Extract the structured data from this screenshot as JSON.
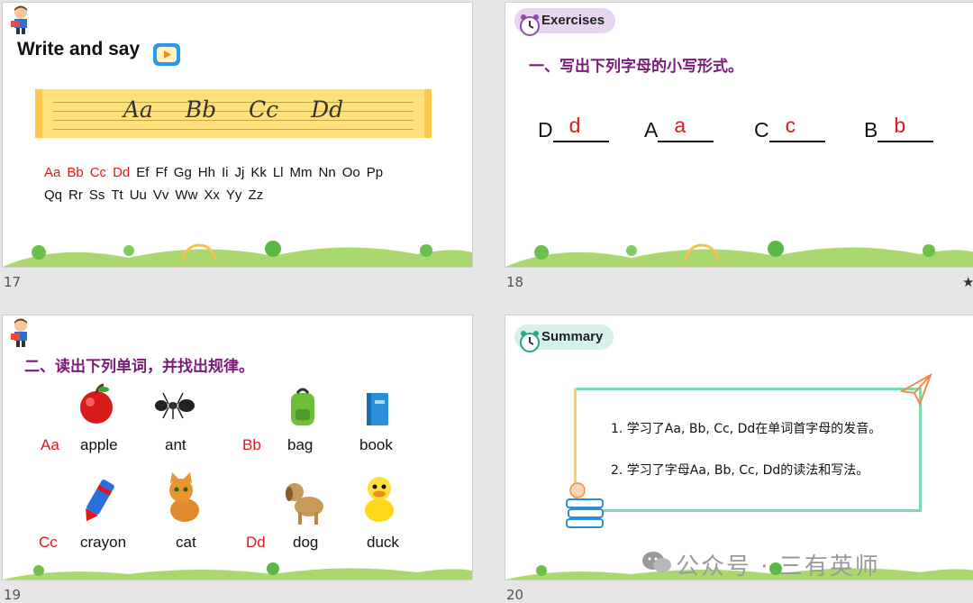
{
  "slides": {
    "s17": {
      "number": "17",
      "title": "Write and say",
      "band_text": "Aa Bb Cc Dd",
      "letters": [
        "Aa",
        "Bb",
        "Cc",
        "Dd",
        "Ef",
        "Ff",
        "Gg",
        "Hh",
        "Ii",
        "Jj",
        "Kk",
        "Ll",
        "Mm",
        "Nn",
        "Oo",
        "Pp",
        "Qq",
        "Rr",
        "Ss",
        "Tt",
        "Uu",
        "Vv",
        "Ww",
        "Xx",
        "Yy",
        "Zz"
      ],
      "highlighted_count": 4
    },
    "s18": {
      "number": "18",
      "badge": "Exercises",
      "heading": "一、写出下列字母的小写形式。",
      "exercises": [
        {
          "upper": "D",
          "answer": "d"
        },
        {
          "upper": "A",
          "answer": "a"
        },
        {
          "upper": "C",
          "answer": "c"
        },
        {
          "upper": "B",
          "answer": "b"
        }
      ]
    },
    "s19": {
      "number": "19",
      "heading": "二、读出下列单词，并找出规律。",
      "rows": [
        {
          "letter": "Aa",
          "words": [
            "apple",
            "ant"
          ]
        },
        {
          "letter": "Bb",
          "words": [
            "bag",
            "book"
          ]
        },
        {
          "letter": "Cc",
          "words": [
            "crayon",
            "cat"
          ]
        },
        {
          "letter": "Dd",
          "words": [
            "dog",
            "duck"
          ]
        }
      ]
    },
    "s20": {
      "number": "20",
      "badge": "Summary",
      "items": [
        "1. 学习了Aa, Bb, Cc, Dd在单词首字母的发音。",
        "2. 学习了字母Aa, Bb, Cc, Dd的读法和写法。"
      ]
    }
  },
  "watermark": "公众号 · 三有英师",
  "colors": {
    "red": "#e01818",
    "heading_purple": "#7a1a7a",
    "band_yellow": "#ffe07a",
    "frame_green": "#7ed9b5"
  }
}
